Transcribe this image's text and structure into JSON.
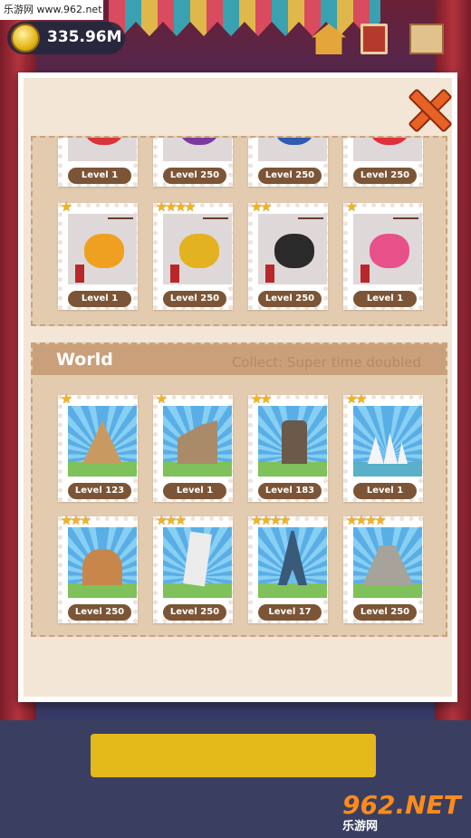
{
  "watermark_top": "乐游网 www.962.net",
  "watermark_bottom": {
    "brand": "962.NET",
    "sub": "乐游网"
  },
  "coins": {
    "amount": "335.96M"
  },
  "colors": {
    "accent": "#e86225",
    "panel": "#f3e6d6",
    "badge": "#7b5536",
    "star": "#f3b31a"
  },
  "top_icons": [
    "house-icon",
    "album-icon",
    "mail-icon"
  ],
  "zodiac": {
    "top_row": [
      {
        "level": "Level 1",
        "symbol": "dragon"
      },
      {
        "level": "Level 250",
        "symbol": "snake"
      },
      {
        "level": "Level 250",
        "symbol": "horse"
      },
      {
        "level": "Level 250",
        "symbol": "goat"
      }
    ],
    "bottom_row": [
      {
        "level": "Level 1",
        "stars": 1,
        "symbol": "monkey"
      },
      {
        "level": "Level 250",
        "stars": 4,
        "symbol": "rooster"
      },
      {
        "level": "Level 250",
        "stars": 2,
        "symbol": "dog"
      },
      {
        "level": "Level 1",
        "stars": 1,
        "symbol": "pig"
      }
    ]
  },
  "world": {
    "title": "World",
    "bonus": "Collect: Super time doubled",
    "stamps": [
      {
        "level": "Level 123",
        "stars": 1,
        "landmark": "pyramids"
      },
      {
        "level": "Level 1",
        "stars": 1,
        "landmark": "great-wall"
      },
      {
        "level": "Level 183",
        "stars": 2,
        "landmark": "moai"
      },
      {
        "level": "Level 1",
        "stars": 2,
        "landmark": "opera-house"
      },
      {
        "level": "Level 250",
        "stars": 3,
        "landmark": "colosseum"
      },
      {
        "level": "Level 250",
        "stars": 3,
        "landmark": "leaning-tower"
      },
      {
        "level": "Level 17",
        "stars": 4,
        "landmark": "eiffel-tower"
      },
      {
        "level": "Level 250",
        "stars": 4,
        "landmark": "chichen-itza"
      }
    ]
  }
}
